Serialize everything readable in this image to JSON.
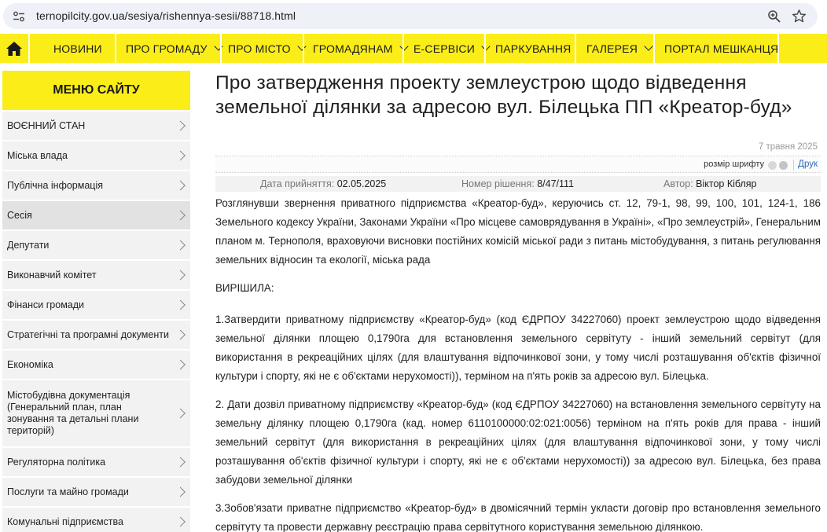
{
  "browser": {
    "url": "ternopilcity.gov.ua/sesiya/rishennya-sesii/88718.html"
  },
  "nav": {
    "items": [
      {
        "label": "НОВИНИ",
        "has_dropdown": false
      },
      {
        "label": "ПРО ГРОМАДУ",
        "has_dropdown": true
      },
      {
        "label": "ПРО МІСТО",
        "has_dropdown": true
      },
      {
        "label": "ГРОМАДЯНАМ",
        "has_dropdown": true
      },
      {
        "label": "Е-СЕРВІСИ",
        "has_dropdown": true
      },
      {
        "label": "ПАРКУВАННЯ",
        "has_dropdown": false
      },
      {
        "label": "ГАЛЕРЕЯ",
        "has_dropdown": true
      },
      {
        "label": "ПОРТАЛ МЕШКАНЦЯ",
        "has_dropdown": false
      }
    ],
    "accent_color": "#fbee18"
  },
  "sidebar": {
    "heading": "МЕНЮ САЙТУ",
    "items": [
      {
        "label": "ВОЄННИЙ СТАН"
      },
      {
        "label": "Міська влада"
      },
      {
        "label": "Публічна інформація"
      },
      {
        "label": "Сесія",
        "active": true
      },
      {
        "label": "Депутати"
      },
      {
        "label": "Виконавчий комітет"
      },
      {
        "label": "Фінанси громади"
      },
      {
        "label": "Стратегічні та програмні документи"
      },
      {
        "label": "Економіка"
      },
      {
        "label": "Містобудівна документація (Генеральний план, план зонування та детальні плани територій)"
      },
      {
        "label": "Регуляторна політика"
      },
      {
        "label": "Послуги та майно громади"
      },
      {
        "label": "Комунальні підприємства"
      }
    ]
  },
  "article": {
    "title": "Про затвердження проекту землеустрою щодо відведення земельної ділянки за адресою вул. Білецька ПП «Креатор-буд»",
    "published": "7 травня 2025",
    "tools": {
      "font_size_label": "розмір шрифту",
      "print_label": "Друк"
    },
    "meta": {
      "adopted_label": "Дата прийняття:",
      "adopted_value": "02.05.2025",
      "number_label": "Номер рішення:",
      "number_value": "8/47/111",
      "author_label": "Автор:",
      "author_value": "Віктор Кібляр"
    },
    "paragraphs": [
      "Розглянувши звернення приватного підприємства «Креатор-буд», керуючись ст. 12, 79-1, 98, 99, 100, 101, 124-1, 186 Земельного кодексу України, Законами України «Про місцеве самоврядування в Україні», «Про землеустрій», Генеральним планом м. Тернополя, враховуючи висновки постійних комісій міської ради з питань містобудування, з питань регулювання земельних відносин та екології, міська рада",
      "ВИРІШИЛА:",
      "1.Затвердити приватному підприємству «Креатор-буд» (код ЄДРПОУ 34227060) проект землеустрою щодо відведення земельної ділянки площею 0,1790га для встановлення земельного сервітуту  - інший земельний сервітут (для використання в рекреаційних цілях (для влаштування відпочинкової зони, у тому числі розташування об'єктів фізичної культури і спорту, які не є об'єктами нерухомості)), терміном на п'ять років  за адресою вул. Білецька.",
      "2. Дати дозвіл приватному підприємству «Креатор-буд» (код ЄДРПОУ 34227060) на встановлення земельного сервітуту на земельну ділянку площею 0,1790га (кад. номер 6110100000:02:021:0056) терміном на п'ять років для права - інший земельний сервітут (для використання в рекреаційних цілях (для влаштування відпочинкової зони, у тому числі розташування об'єктів фізичної культури і спорту, які не є об'єктами нерухомості))  за адресою вул. Білецька, без права забудови земельної ділянки",
      "3.Зобов'язати приватне підприємство «Креатор-буд» в двомісячний термін укласти договір про встановлення земельного сервітуту та провести державну реєстрацію права сервітутного користування земельною ділянкою."
    ]
  }
}
